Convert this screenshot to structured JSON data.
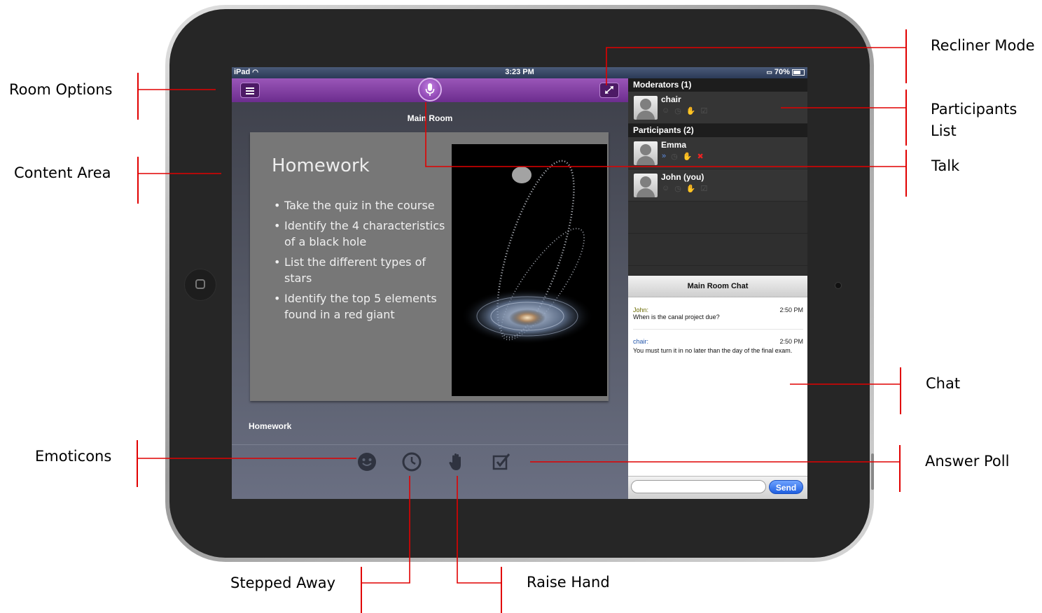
{
  "callouts": {
    "room_options": "Room Options",
    "content_area": "Content Area",
    "emoticons": "Emoticons",
    "stepped_away": "Stepped Away",
    "raise_hand": "Raise Hand",
    "recliner_mode": "Recliner Mode",
    "participants_list_1": "Participants",
    "participants_list_2": "List",
    "talk": "Talk",
    "chat": "Chat",
    "answer_poll": "Answer Poll"
  },
  "status_bar": {
    "device": "iPad",
    "time": "3:23 PM",
    "battery": "70%"
  },
  "room": {
    "title": "Main Room",
    "content_caption": "Homework"
  },
  "slide": {
    "title": "Homework",
    "bullets": [
      "Take the quiz in the course",
      "Identify the 4 characteristics of a black hole",
      "List the different types of stars",
      "Identify the top 5 elements found in a red giant"
    ]
  },
  "moderators": {
    "header": "Moderators (1)",
    "list": [
      {
        "name": "chair"
      }
    ]
  },
  "participants": {
    "header": "Participants (2)",
    "list": [
      {
        "name": "Emma"
      },
      {
        "name": "John (you)"
      }
    ]
  },
  "chat": {
    "title": "Main Room Chat",
    "messages": [
      {
        "sender": "John:",
        "time": "2:50 PM",
        "text": "When is the canal project due?",
        "sender_color": "#6b6b00"
      },
      {
        "sender": "chair:",
        "time": "2:50 PM",
        "text": "You must turn it in no later than the day of the final exam.",
        "sender_color": "#2255aa"
      }
    ],
    "input_placeholder": "",
    "send_label": "Send"
  },
  "status_icons": [
    "smiley-icon",
    "clock-icon",
    "raise-hand-icon",
    "poll-check-icon"
  ],
  "colors": {
    "toolbar_purple": "#7b3a9c",
    "callout_line": "#e10000",
    "send_blue": "#2a6ee8"
  }
}
